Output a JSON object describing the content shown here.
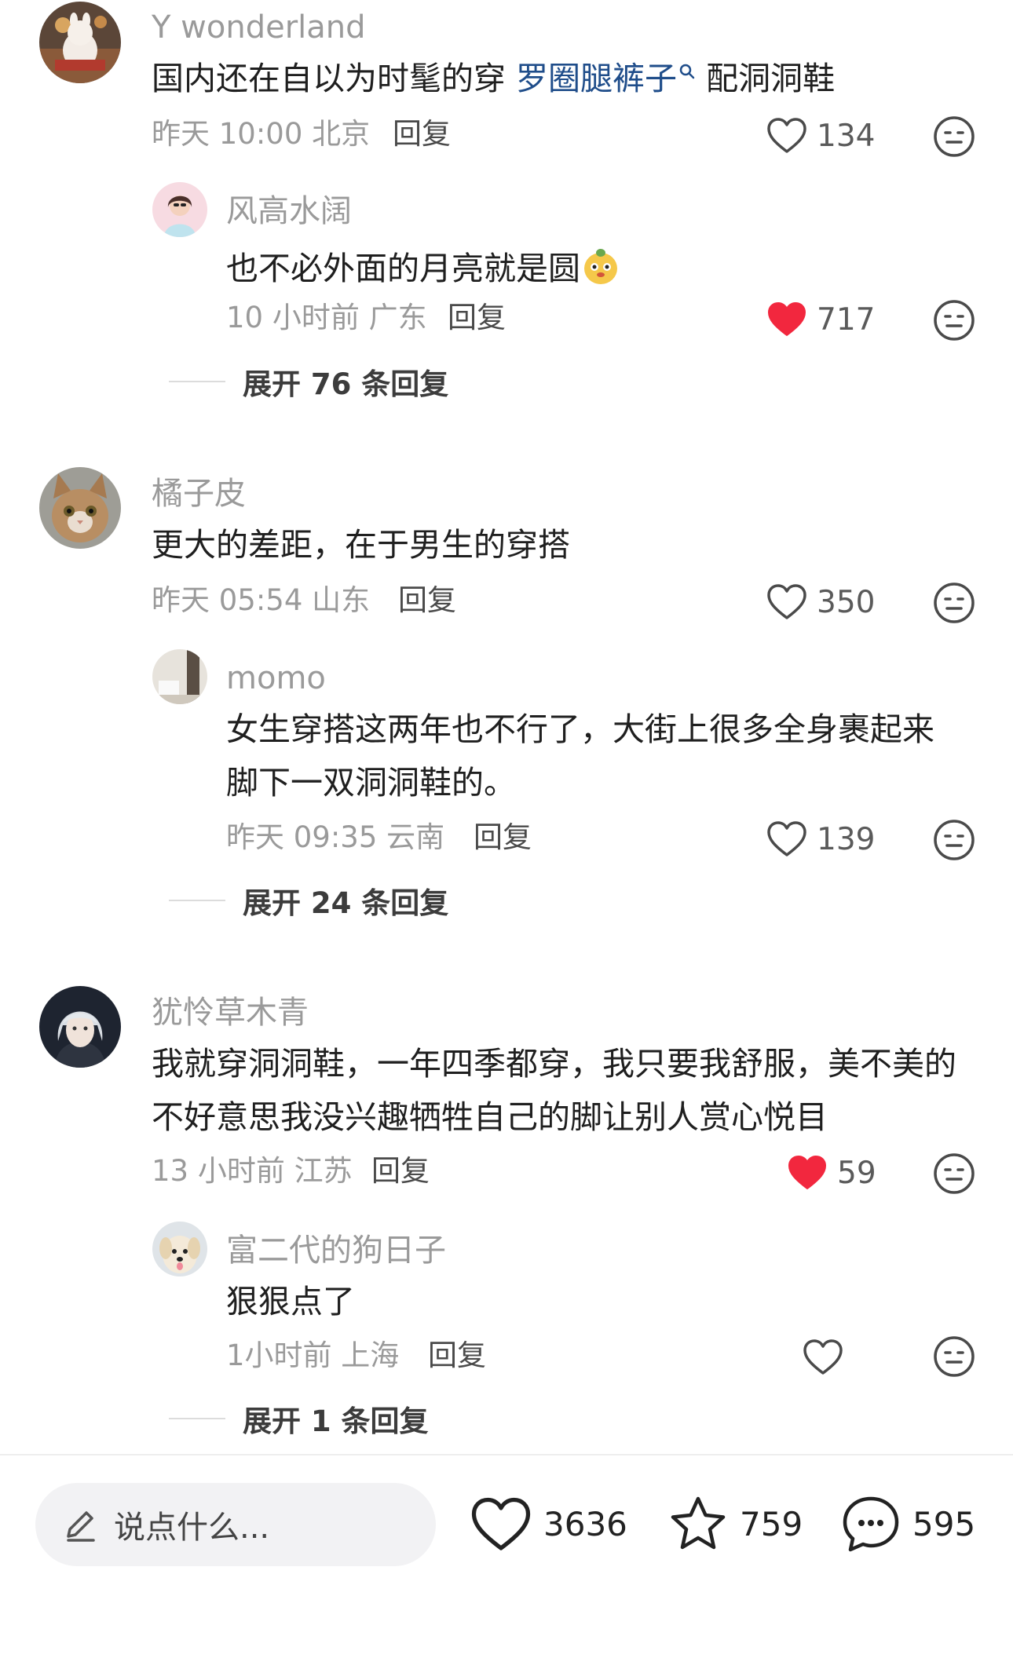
{
  "comments": [
    {
      "user": "Y wonderland",
      "text_before": "国内还在自以为时髦的穿 ",
      "text_link": "罗圈腿裤子",
      "text_after": " 配洞洞鞋",
      "meta": "昨天 10:00 北京",
      "reply_label": "回复",
      "likes": "134",
      "liked": false,
      "replies": [
        {
          "user": "风高水阔",
          "text": "也不必外面的月亮就是圆",
          "meta": "10 小时前 广东",
          "reply_label": "回复",
          "likes": "717",
          "liked": true
        }
      ],
      "expand_label": "展开 76 条回复"
    },
    {
      "user": "橘子皮",
      "text": "更大的差距，在于男生的穿搭",
      "meta": "昨天 05:54 山东",
      "reply_label": "回复",
      "likes": "350",
      "liked": false,
      "replies": [
        {
          "user": "momo",
          "text_line1": "女生穿搭这两年也不行了，大街上很多全身裹起来",
          "text_line2": "脚下一双洞洞鞋的。",
          "meta": "昨天 09:35 云南",
          "reply_label": "回复",
          "likes": "139",
          "liked": false
        }
      ],
      "expand_label": "展开 24 条回复"
    },
    {
      "user": "犹怜草木青",
      "text_line1": "我就穿洞洞鞋，一年四季都穿，我只要我舒服，美不美的",
      "text_line2": "不好意思我没兴趣牺牲自己的脚让别人赏心悦目",
      "meta": "13 小时前 江苏",
      "reply_label": "回复",
      "likes": "59",
      "liked": true,
      "replies": [
        {
          "user": "富二代的狗日子",
          "text": "狠狠点了",
          "meta": "1小时前 上海",
          "reply_label": "回复",
          "likes": "",
          "liked": false
        }
      ],
      "expand_label": "展开 1 条回复"
    }
  ],
  "bottom_bar": {
    "input_placeholder": "说点什么...",
    "like_count": "3636",
    "star_count": "759",
    "comment_count": "595"
  },
  "colors": {
    "liked_heart": "#f2273e",
    "link": "#1f4d8a",
    "muted_text": "#9a9a9a"
  },
  "icons": [
    "heart-outline-icon",
    "heart-filled-icon",
    "dislike-face-icon",
    "search-small-icon",
    "pencil-icon",
    "star-icon",
    "comment-bubble-icon"
  ]
}
